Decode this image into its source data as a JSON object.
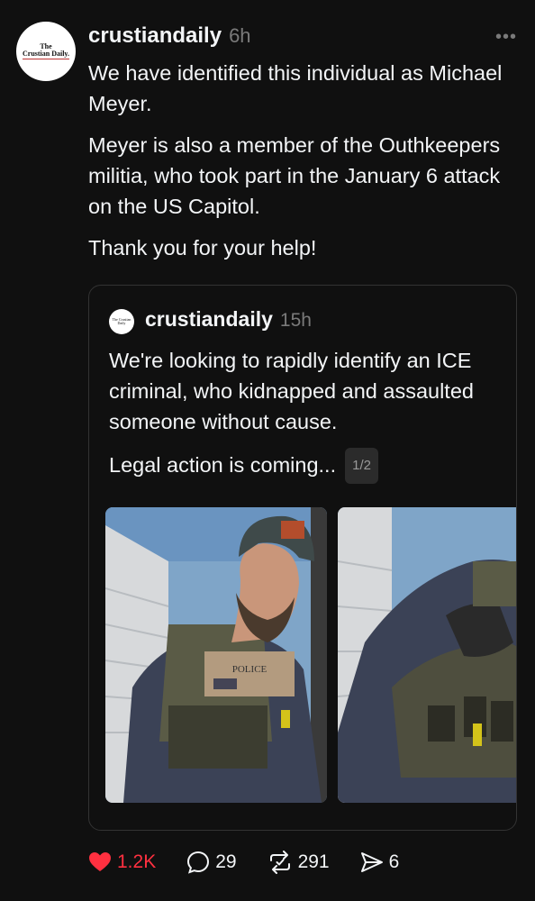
{
  "post": {
    "author": {
      "username": "crustiandaily",
      "avatar_text_line1": "The",
      "avatar_text_line2": "Crustian Daily."
    },
    "time": "6h",
    "more_label": "•••",
    "paragraphs": [
      "We have identified this individual as Michael Meyer.",
      "Meyer is also a member of the Outhkeepers militia, who took part in the January 6 attack on the US Capitol.",
      "Thank you for your help!"
    ]
  },
  "quoted_post": {
    "username": "crustiandaily",
    "time": "15h",
    "avatar_text": "The Crustian Daily",
    "paragraphs": [
      "We're looking to rapidly identify an ICE criminal, who kidnapped and assaulted someone without cause.",
      "Legal action is coming..."
    ],
    "media_counter": "1/2",
    "media": [
      {
        "type": "photo",
        "patch_text": "POLICE"
      },
      {
        "type": "photo"
      }
    ]
  },
  "actions": {
    "like": {
      "icon": "heart-icon",
      "count": "1.2K",
      "active_color": "#ff3040"
    },
    "reply": {
      "icon": "comment-icon",
      "count": "29"
    },
    "repost": {
      "icon": "repost-icon",
      "count": "291"
    },
    "share": {
      "icon": "share-icon",
      "count": "6"
    }
  },
  "colors": {
    "background": "#101010",
    "text": "#f3f5f7",
    "muted": "#7a7a7a",
    "like": "#ff3040"
  }
}
